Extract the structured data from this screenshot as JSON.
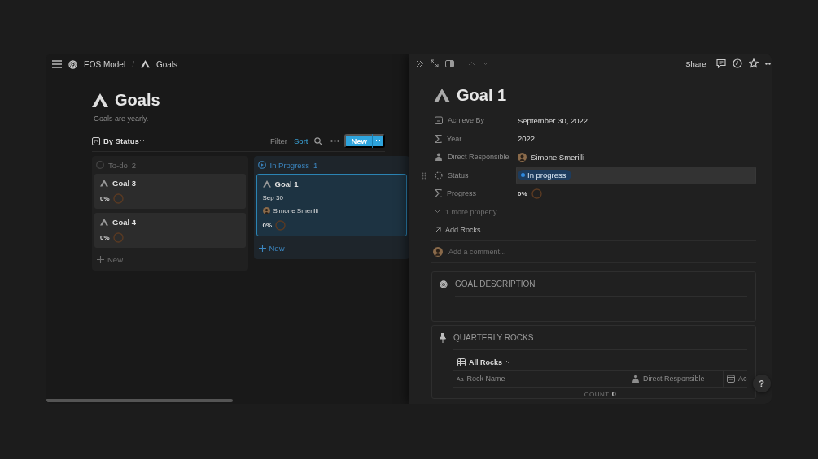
{
  "breadcrumb": [
    {
      "kind": "target",
      "label": "EOS Model"
    },
    {
      "kind": "tent",
      "separator": "/",
      "label": "Goals"
    }
  ],
  "page": {
    "title": "Goals",
    "description": "Goals are yearly."
  },
  "view": {
    "label": "By Status"
  },
  "toolbar": [
    {
      "label": "Filter",
      "active": false
    },
    {
      "label": "Sort",
      "active": true
    }
  ],
  "new_button": "New",
  "columns": [
    {
      "kind": "todo",
      "title": "To-do",
      "count": "2",
      "new_label": "New",
      "cards": [
        {
          "title": "Goal 3",
          "progress": "0%",
          "selected": false
        },
        {
          "title": "Goal 4",
          "progress": "0%",
          "selected": false
        }
      ]
    },
    {
      "kind": "in_progress",
      "title": "In Progress",
      "count": "1",
      "new_label": "New",
      "cards": [
        {
          "title": "Goal 1",
          "date": "Sep 30",
          "person": "Simone Smerilli",
          "progress": "0%",
          "selected": true
        }
      ]
    }
  ],
  "panel": {
    "share": "Share",
    "title": "Goal 1",
    "properties": [
      {
        "kind": "date",
        "label": "Achieve By",
        "value": "September 30, 2022",
        "hovered": false
      },
      {
        "kind": "formula",
        "label": "Year",
        "value": "2022",
        "hovered": false
      },
      {
        "kind": "person",
        "label": "Direct Responsible",
        "value": "Simone Smerilli",
        "hovered": false
      },
      {
        "kind": "status",
        "label": "Status",
        "value": "In progress",
        "hovered": true
      },
      {
        "kind": "progress",
        "label": "Progress",
        "value": "0%",
        "hovered": false
      }
    ],
    "more": "1 more property",
    "add_relation": "Add Rocks",
    "comment_placeholder": "Add a comment...",
    "sections": [
      {
        "kind": "description",
        "title": "GOAL DESCRIPTION"
      },
      {
        "kind": "rocks",
        "title": "QUARTERLY ROCKS",
        "view": "All Rocks",
        "columns": [
          {
            "kind": "title",
            "icon_text": "Aa",
            "label": "Rock Name"
          },
          {
            "kind": "person",
            "label": "Direct Responsible"
          },
          {
            "kind": "date",
            "label": "Ac"
          }
        ],
        "count_label": "COUNT",
        "count": "0"
      }
    ]
  },
  "help": "?"
}
